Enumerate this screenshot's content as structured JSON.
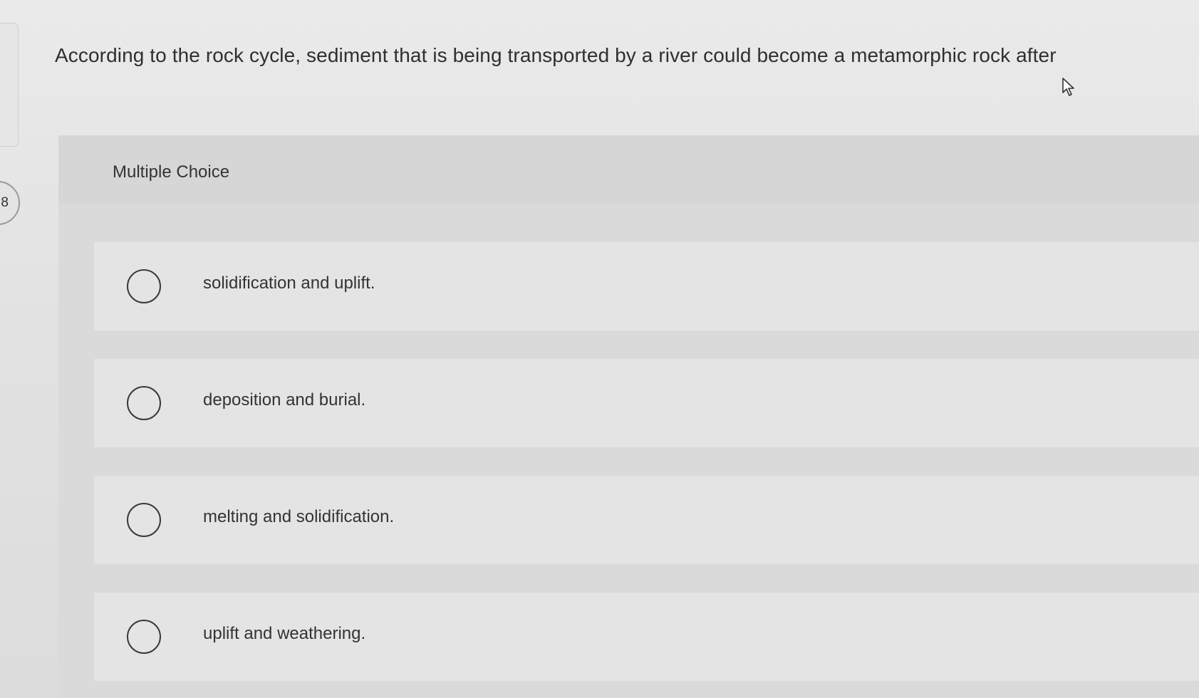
{
  "question": {
    "number": "8",
    "text": "According to the rock cycle, sediment that is being transported by a river could become a metamorphic rock after"
  },
  "section": {
    "header": "Multiple Choice"
  },
  "options": [
    {
      "label": "solidification and uplift."
    },
    {
      "label": "deposition and burial."
    },
    {
      "label": "melting and solidification."
    },
    {
      "label": "uplift and weathering."
    }
  ]
}
